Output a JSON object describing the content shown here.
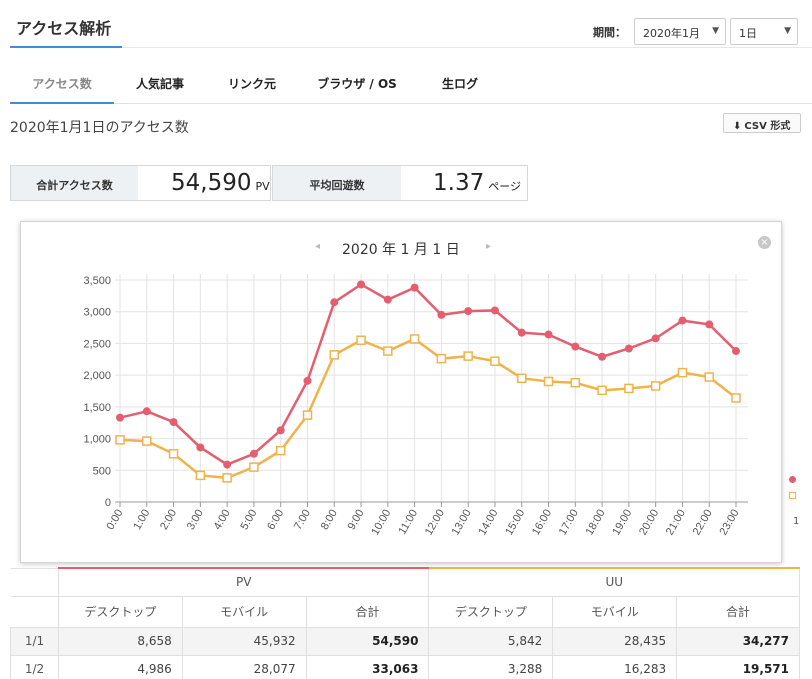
{
  "page": {
    "title": "アクセス解析"
  },
  "period": {
    "label": "期間：",
    "month": "2020年1月",
    "day": "1日"
  },
  "tabs": [
    {
      "label": "アクセス数",
      "active": true
    },
    {
      "label": "人気記事"
    },
    {
      "label": "リンク元"
    },
    {
      "label": "ブラウザ / OS"
    },
    {
      "label": "生ログ"
    }
  ],
  "subtitle": "2020年1月1日のアクセス数",
  "csv_button": {
    "label": "CSV 形式",
    "icon": "download-icon"
  },
  "stats": {
    "total": {
      "label": "合計アクセス数",
      "value": "54,590",
      "unit": "PV"
    },
    "avg": {
      "label": "平均回遊数",
      "value": "1.37",
      "unit": "ページ"
    }
  },
  "chart_nav": {
    "prev": "◂",
    "next": "▸",
    "close": "×"
  },
  "chart_data": {
    "type": "line",
    "title": "2020 年 1 月 1 日",
    "x": [
      "0:00",
      "1:00",
      "2:00",
      "3:00",
      "4:00",
      "5:00",
      "6:00",
      "7:00",
      "8:00",
      "9:00",
      "10:00",
      "11:00",
      "12:00",
      "13:00",
      "14:00",
      "15:00",
      "16:00",
      "17:00",
      "18:00",
      "19:00",
      "20:00",
      "21:00",
      "22:00",
      "23:00"
    ],
    "series": [
      {
        "name": "PV",
        "color": "#e35f6f",
        "marker": "circle",
        "values": [
          1330,
          1430,
          1260,
          860,
          590,
          760,
          1130,
          1910,
          3150,
          3430,
          3190,
          3380,
          2950,
          3010,
          3020,
          2670,
          2640,
          2450,
          2290,
          2420,
          2580,
          2860,
          2800,
          2380
        ]
      },
      {
        "name": "UU",
        "color": "#f1b24a",
        "marker": "square",
        "values": [
          980,
          960,
          760,
          420,
          380,
          550,
          810,
          1370,
          2320,
          2550,
          2380,
          2570,
          2260,
          2300,
          2220,
          1950,
          1900,
          1880,
          1760,
          1790,
          1830,
          2040,
          1970,
          1640
        ]
      }
    ],
    "ylim": [
      0,
      3500
    ],
    "yticks": [
      "0",
      "500",
      "1,000",
      "1,500",
      "2,000",
      "2,500",
      "3,000",
      "3,500"
    ],
    "grid": true
  },
  "peek_tick": "1",
  "table": {
    "groups": [
      "PV",
      "UU"
    ],
    "columns": [
      "デスクトップ",
      "モバイル",
      "合計",
      "デスクトップ",
      "モバイル",
      "合計"
    ],
    "rows": [
      {
        "date": "1/1",
        "cells": [
          "8,658",
          "45,932",
          "54,590",
          "5,842",
          "28,435",
          "34,277"
        ]
      },
      {
        "date": "1/2",
        "cells": [
          "4,986",
          "28,077",
          "33,063",
          "3,288",
          "16,283",
          "19,571"
        ]
      }
    ]
  }
}
